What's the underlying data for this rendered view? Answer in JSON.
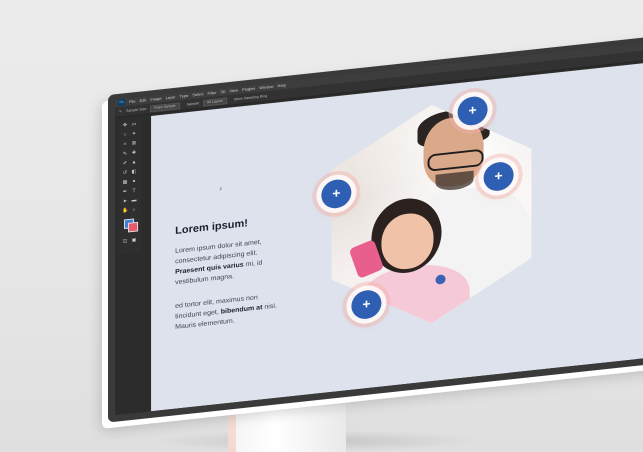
{
  "app": {
    "logo_text": "Ps",
    "menu": [
      "File",
      "Edit",
      "Image",
      "Layer",
      "Type",
      "Select",
      "Filter",
      "3D",
      "View",
      "Plugins",
      "Window",
      "Help"
    ],
    "options": {
      "sample_label": "Sample Size:",
      "sample_value": "Point Sample",
      "sample2_label": "Sample:",
      "sample2_value": "All Layers",
      "show_ring": "Show Sampling Ring"
    },
    "colors": {
      "foreground": "#3d7fd6",
      "background": "#e85a6b",
      "accent": "#2f5fb3"
    }
  },
  "canvas": {
    "heading": "Lorem ipsum!",
    "para1_a": "Lorem ipsum dolor sit amet, consectetur adipiscing elit.",
    "para1_bold": "Praesent quis varius",
    "para1_b": "mi, id vestibulum magna.",
    "para2_a": "ed tortor elit, maximus non tincidunt eget,",
    "para2_bold": "bibendum at",
    "para2_b": "nisi. Mauris elementum.",
    "hotspot_label": "+"
  }
}
